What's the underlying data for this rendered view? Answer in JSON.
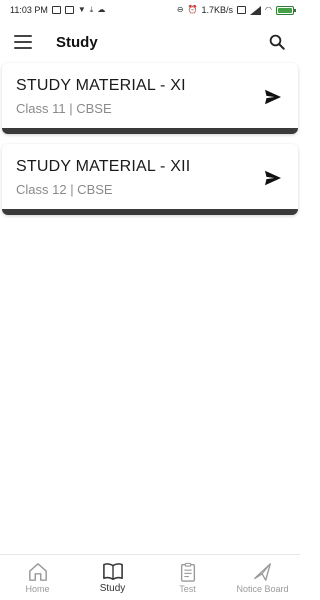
{
  "status_bar": {
    "time": "11:03 PM",
    "net_speed": "1.7KB/s",
    "battery_color": "#43a047"
  },
  "app_bar": {
    "title": "Study",
    "menu_icon": "hamburger-icon",
    "search_icon": "search-icon"
  },
  "cards": [
    {
      "title": "STUDY MATERIAL - XI",
      "subtitle": "Class 11 | CBSE",
      "icon": "send-icon"
    },
    {
      "title": "STUDY MATERIAL - XII",
      "subtitle": "Class 12 | CBSE",
      "icon": "send-icon"
    }
  ],
  "bottom_nav": {
    "items": [
      {
        "label": "Home",
        "icon": "home-icon",
        "active": false
      },
      {
        "label": "Study",
        "icon": "book-icon",
        "active": true
      },
      {
        "label": "Test",
        "icon": "clipboard-icon",
        "active": false
      },
      {
        "label": "Notice Board",
        "icon": "megaphone-icon",
        "active": false
      }
    ]
  }
}
